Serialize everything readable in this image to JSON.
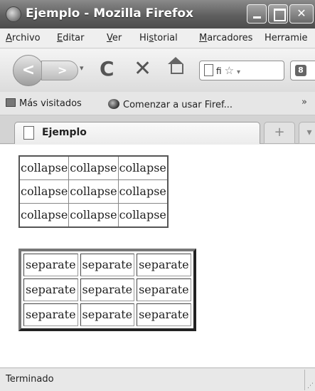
{
  "window": {
    "title": "Ejemplo - Mozilla Firefox"
  },
  "menu": {
    "items": [
      {
        "pre": "",
        "u": "A",
        "post": "rchivo"
      },
      {
        "pre": "",
        "u": "E",
        "post": "ditar"
      },
      {
        "pre": "",
        "u": "V",
        "post": "er"
      },
      {
        "pre": "Hi",
        "u": "s",
        "post": "torial"
      },
      {
        "pre": "",
        "u": "M",
        "post": "arcadores"
      },
      {
        "pre": "Herramie",
        "u": "",
        "post": ""
      }
    ]
  },
  "navbar": {
    "url_text": "fi"
  },
  "bookmarks": {
    "items": [
      "Más visitados",
      "Comenzar a usar Firef..."
    ],
    "overflow": "»"
  },
  "tabs": [
    {
      "label": "Ejemplo"
    }
  ],
  "content": {
    "collapse_table": [
      [
        "collapse",
        "collapse",
        "collapse"
      ],
      [
        "collapse",
        "collapse",
        "collapse"
      ],
      [
        "collapse",
        "collapse",
        "collapse"
      ]
    ],
    "separate_table": [
      [
        "separate",
        "separate",
        "separate"
      ],
      [
        "separate",
        "separate",
        "separate"
      ],
      [
        "separate",
        "separate",
        "separate"
      ]
    ]
  },
  "status": {
    "text": "Terminado"
  }
}
